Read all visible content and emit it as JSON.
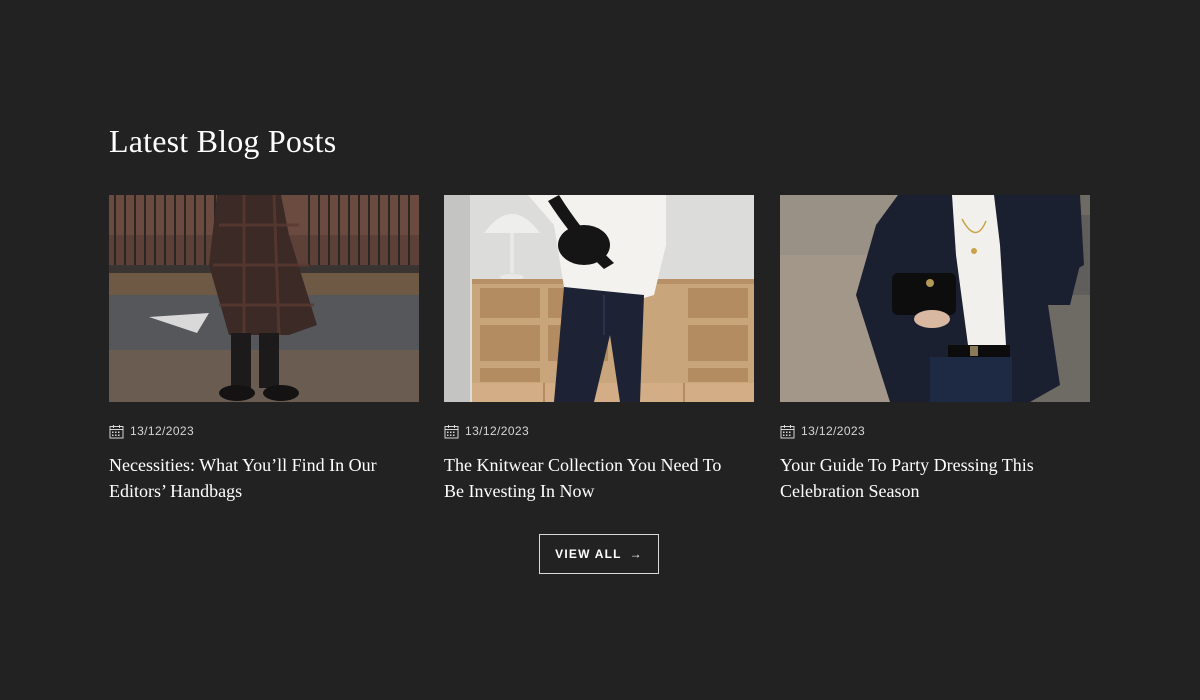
{
  "section": {
    "title": "Latest Blog Posts"
  },
  "posts": [
    {
      "date": "13/12/2023",
      "title": "Necessities: What You’ll Find In Our Editors’ Handbags",
      "image_icon": "photo-plaid-coat-walking-street"
    },
    {
      "date": "13/12/2023",
      "title": "The Knitwear Collection You Need To Be Investing In Now",
      "image_icon": "photo-white-knit-wooden-shelf"
    },
    {
      "date": "13/12/2023",
      "title": "Your Guide To Party Dressing This Celebration Season",
      "image_icon": "photo-navy-blazer-black-bag"
    }
  ],
  "view_all": {
    "label": "VIEW ALL",
    "arrow": "→"
  },
  "colors": {
    "background": "#222222",
    "text": "#ffffff",
    "muted_text": "#d6d6d6",
    "button_border": "#d9d9d9"
  }
}
